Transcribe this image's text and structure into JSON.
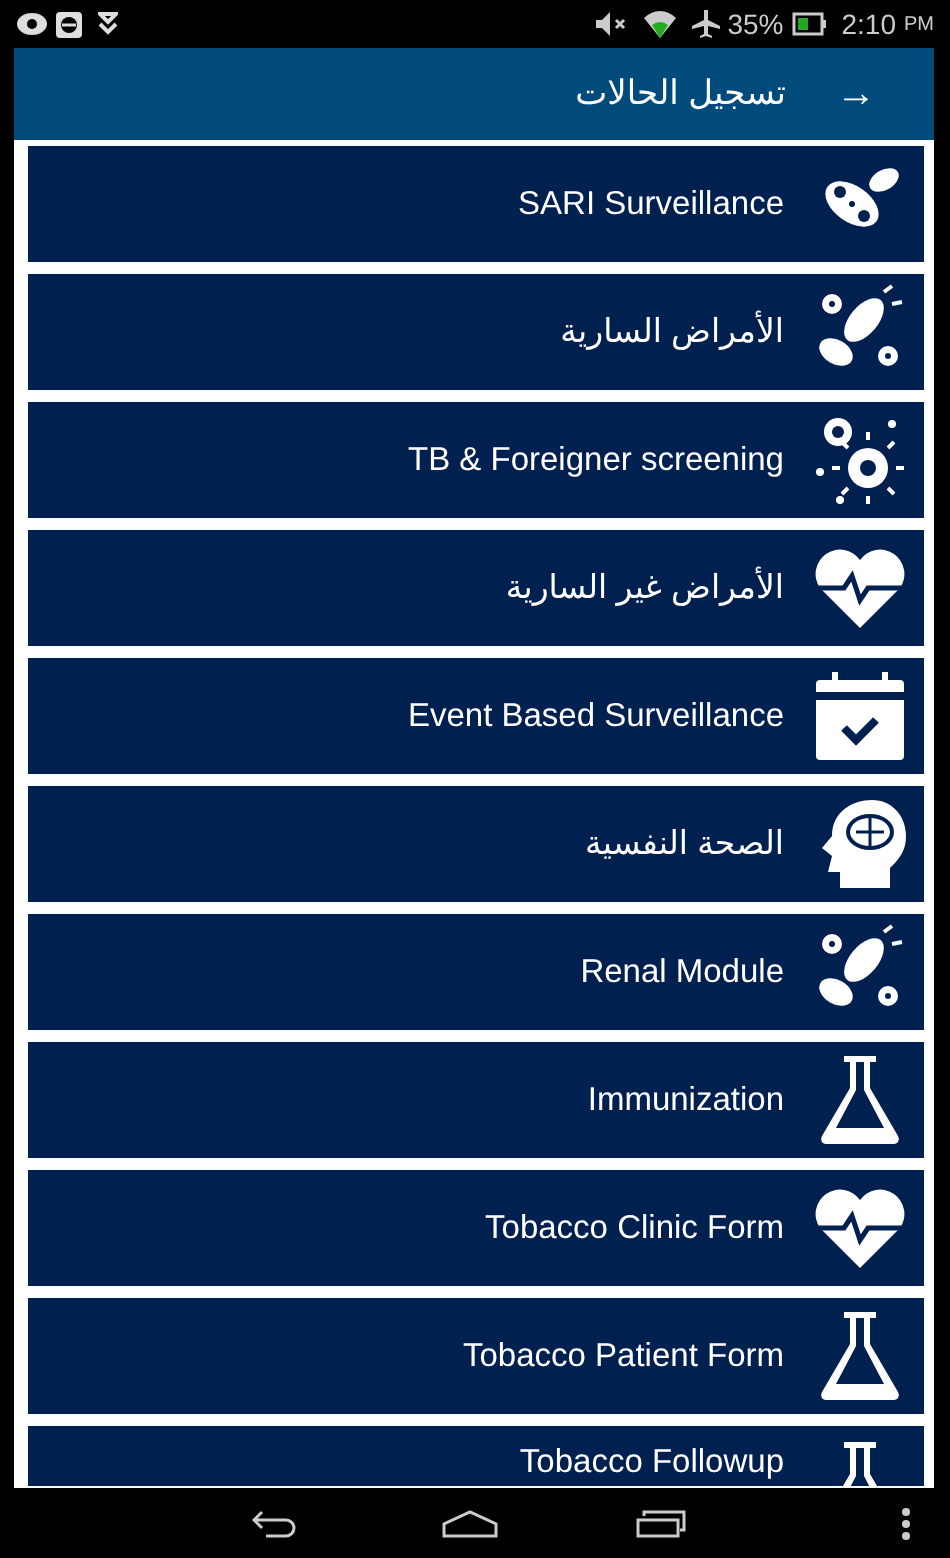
{
  "status_bar": {
    "battery": "35%",
    "time": "2:10",
    "period": "PM"
  },
  "header": {
    "title": "تسجيل الحالات",
    "back": "→"
  },
  "menu_items": [
    {
      "label": "SARI Surveillance"
    },
    {
      "label": "الأمراض السارية"
    },
    {
      "label": "TB & Foreigner screening"
    },
    {
      "label": "الأمراض غير السارية"
    },
    {
      "label": "Event Based Surveillance"
    },
    {
      "label": "الصحة النفسية"
    },
    {
      "label": "Renal Module"
    },
    {
      "label": "Immunization"
    },
    {
      "label": "Tobacco Clinic Form"
    },
    {
      "label": "Tobacco Patient Form"
    },
    {
      "label": "Tobacco Followup"
    }
  ]
}
